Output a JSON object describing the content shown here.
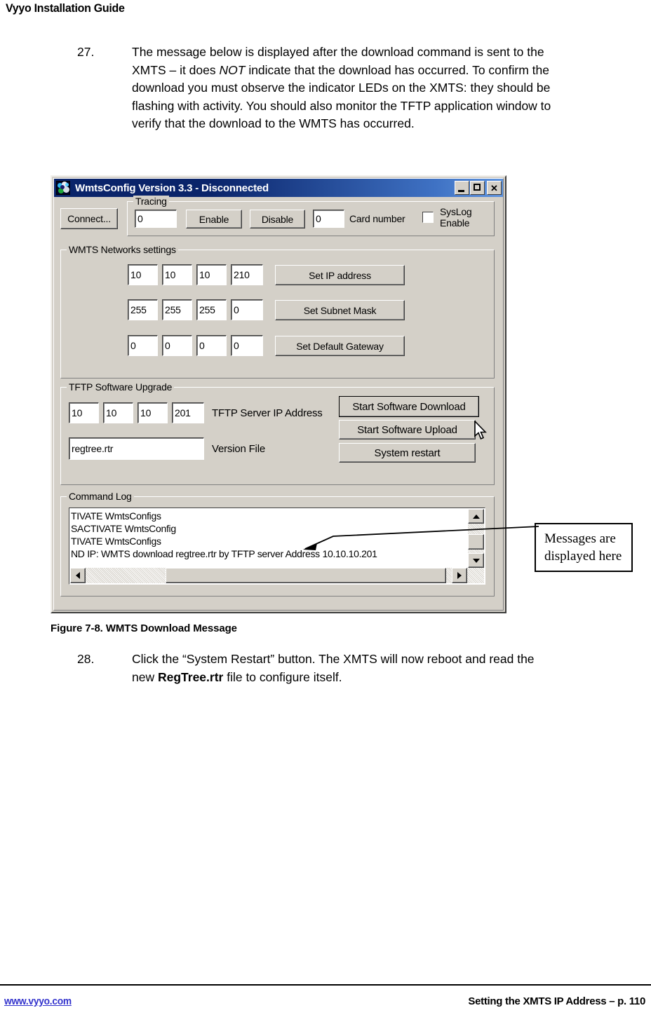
{
  "document": {
    "header_title": "Vyyo Installation Guide",
    "figure_caption": "Figure 7-8. WMTS Download Message",
    "footer": {
      "link": "www.vyyo.com",
      "right": "Setting the XMTS IP Address – p. 110"
    }
  },
  "steps": [
    {
      "number": "27.",
      "text_part1": "The message below is displayed after the download command is sent to the XMTS – it does ",
      "emphasis": "NOT",
      "text_part2": " indicate that the download has occurred.  To confirm the download you must observe the indicator LEDs on the XMTS: they should be flashing with activity.  You should also monitor the TFTP application window to verify that the download to the WMTS has occurred."
    },
    {
      "number": "28.",
      "text_part1": "Click the “System Restart” button. The XMTS will now reboot and read the new ",
      "emphasis": "RegTree.rtr",
      "text_part2": " file to configure itself."
    }
  ],
  "callout": {
    "line1": "Messages are",
    "line2": "displayed here"
  },
  "window": {
    "title": "WmtsConfig Version 3.3 - Disconnected",
    "caption_buttons": {
      "minimize": "minimize-icon",
      "maximize": "maximize-icon",
      "close": "✕"
    },
    "connect_button": "Connect...",
    "tracing": {
      "group_title": "Tracing",
      "trace_value": "0",
      "enable_button": "Enable",
      "disable_button": "Disable",
      "card_number_value": "0",
      "card_number_label": "Card number",
      "syslog_label_line1": "SysLog",
      "syslog_label_line2": "Enable",
      "syslog_checked": false
    },
    "networks": {
      "group_title": "WMTS Networks settings",
      "ip_octets": [
        "10",
        "10",
        "10",
        "210"
      ],
      "ip_button": "Set IP address",
      "mask_octets": [
        "255",
        "255",
        "255",
        "0"
      ],
      "mask_button": "Set Subnet Mask",
      "gateway_octets": [
        "0",
        "0",
        "0",
        "0"
      ],
      "gateway_button": "Set Default Gateway"
    },
    "tftp": {
      "group_title": "TFTP Software Upgrade",
      "server_octets": [
        "10",
        "10",
        "10",
        "201"
      ],
      "server_label": "TFTP Server IP Address",
      "version_file_value": "regtree.rtr",
      "version_file_label": "Version File",
      "download_button": "Start Software Download",
      "upload_button": "Start Software Upload",
      "restart_button": "System restart"
    },
    "command_log": {
      "group_title": "Command Log",
      "lines": [
        "TIVATE WmtsConfigs",
        "SACTIVATE WmtsConfig",
        "TIVATE WmtsConfigs",
        "ND IP: WMTS download regtree.rtr by TFTP server Address 10.10.10.201"
      ]
    }
  }
}
